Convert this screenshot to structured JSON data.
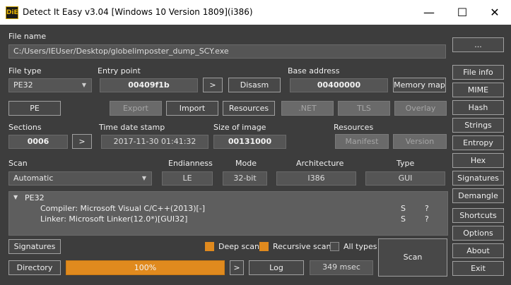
{
  "window": {
    "title": "Detect It Easy v3.04 [Windows 10 Version 1809](i386)",
    "icon_text": "DiE",
    "controls": {
      "minimize": "—",
      "maximize": "☐",
      "close": "✕"
    }
  },
  "file": {
    "label": "File name",
    "path": "C:/Users/IEUser/Desktop/globelimposter_dump_SCY.exe",
    "browse_label": "..."
  },
  "file_type": {
    "label": "File type",
    "value": "PE32"
  },
  "entry_point": {
    "label": "Entry point",
    "value": "00409f1b",
    "go_label": ">",
    "disasm_label": "Disasm"
  },
  "base_address": {
    "label": "Base address",
    "value": "00400000",
    "memory_map_label": "Memory map"
  },
  "row_buttons": {
    "pe": "PE",
    "export": "Export",
    "import": "Import",
    "resources": "Resources",
    "net": ".NET",
    "tls": "TLS",
    "overlay": "Overlay"
  },
  "sections": {
    "label": "Sections",
    "value": "0006",
    "go_label": ">"
  },
  "timestamp": {
    "label": "Time date stamp",
    "value": "2017-11-30 01:41:32"
  },
  "image_size": {
    "label": "Size of image",
    "value": "00131000"
  },
  "resources_group": {
    "label": "Resources",
    "manifest": "Manifest",
    "version": "Version"
  },
  "scan": {
    "label": "Scan",
    "mode_value": "Automatic",
    "endianness_label": "Endianness",
    "endianness": "LE",
    "mode_label": "Mode",
    "mode": "32-bit",
    "arch_label": "Architecture",
    "arch": "I386",
    "type_label": "Type",
    "type": "GUI"
  },
  "results": {
    "root": "PE32",
    "items": [
      {
        "text": "Compiler: Microsoft Visual C/C++(2013)[-]",
        "s": "S",
        "q": "?"
      },
      {
        "text": "Linker: Microsoft Linker(12.0*)[GUI32]",
        "s": "S",
        "q": "?"
      }
    ]
  },
  "options": {
    "signatures": "Signatures",
    "deep_scan": "Deep scan",
    "recursive_scan": "Recursive scan",
    "all_types": "All types",
    "scan_button": "Scan"
  },
  "bottom": {
    "directory": "Directory",
    "progress_text": "100%",
    "progress": 1.0,
    "go_label": ">",
    "log": "Log",
    "elapsed": "349 msec"
  },
  "sidebar": [
    "File info",
    "MIME",
    "Hash",
    "Strings",
    "Entropy",
    "Hex",
    "Signatures",
    "Demangle",
    "Shortcuts",
    "Options",
    "About",
    "Exit"
  ],
  "colors": {
    "accent": "#e08a1e",
    "background": "#3d3d3d"
  }
}
